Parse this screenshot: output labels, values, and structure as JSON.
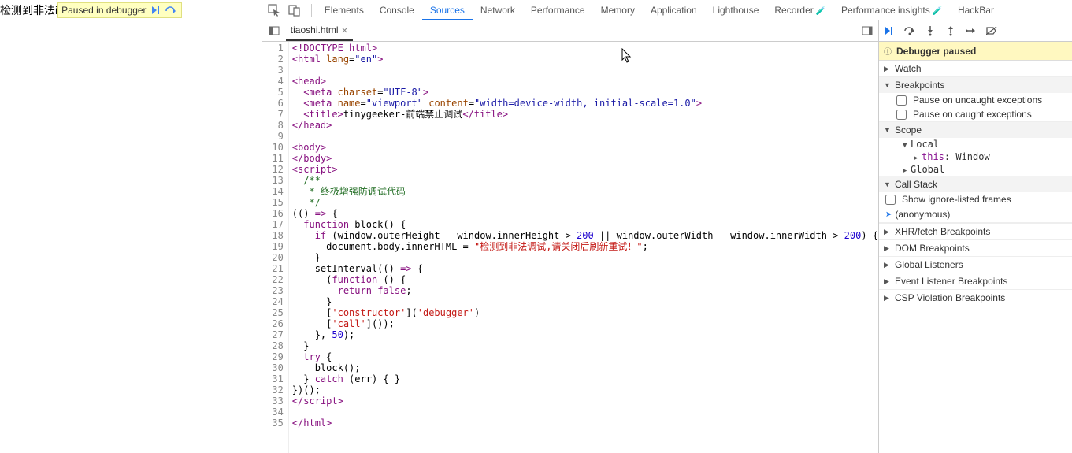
{
  "leftPane": {
    "detectedText": "检测到非法i",
    "pausedLabel": "Paused in debugger"
  },
  "tabs": [
    "Elements",
    "Console",
    "Sources",
    "Network",
    "Performance",
    "Memory",
    "Application",
    "Lighthouse",
    "Recorder",
    "Performance insights",
    "HackBar"
  ],
  "activeTab": "Sources",
  "experimentTabs": [
    "Recorder",
    "Performance insights"
  ],
  "fileTab": {
    "name": "tiaoshi.html"
  },
  "code": {
    "lines": [
      {
        "n": 1,
        "html": "<span class='tag'>&lt;!DOCTYPE html&gt;</span>"
      },
      {
        "n": 2,
        "html": "<span class='tag'>&lt;html</span> <span class='attrn'>lang</span>=<span class='attrv'>\"en\"</span><span class='tag'>&gt;</span>"
      },
      {
        "n": 3,
        "html": ""
      },
      {
        "n": 4,
        "html": "<span class='tag'>&lt;head&gt;</span>"
      },
      {
        "n": 5,
        "html": "  <span class='tag'>&lt;meta</span> <span class='attrn'>charset</span>=<span class='attrv'>\"UTF-8\"</span><span class='tag'>&gt;</span>"
      },
      {
        "n": 6,
        "html": "  <span class='tag'>&lt;meta</span> <span class='attrn'>name</span>=<span class='attrv'>\"viewport\"</span> <span class='attrn'>content</span>=<span class='attrv'>\"width=device-width, initial-scale=1.0\"</span><span class='tag'>&gt;</span>"
      },
      {
        "n": 7,
        "html": "  <span class='tag'>&lt;title&gt;</span>tinygeeker-前端禁止调试<span class='tag'>&lt;/title&gt;</span>"
      },
      {
        "n": 8,
        "html": "<span class='tag'>&lt;/head&gt;</span>"
      },
      {
        "n": 9,
        "html": ""
      },
      {
        "n": 10,
        "html": "<span class='tag'>&lt;body&gt;</span>"
      },
      {
        "n": 11,
        "html": "<span class='tag'>&lt;/body&gt;</span>"
      },
      {
        "n": 12,
        "html": "<span class='tag'>&lt;script&gt;</span>"
      },
      {
        "n": 13,
        "html": "  <span class='cmt'>/**</span>"
      },
      {
        "n": 14,
        "html": "  <span class='cmt'> * 终极增强防调试代码</span>"
      },
      {
        "n": 15,
        "html": "  <span class='cmt'> */</span>"
      },
      {
        "n": 16,
        "html": "(() <span class='kw'>=&gt;</span> {"
      },
      {
        "n": 17,
        "html": "  <span class='kw'>function</span> block() {"
      },
      {
        "n": 18,
        "html": "    <span class='kw'>if</span> (window.outerHeight - window.innerHeight &gt; <span class='num'>200</span> || window.outerWidth - window.innerWidth &gt; <span class='num'>200</span>) {"
      },
      {
        "n": 19,
        "html": "      document.body.innerHTML = <span class='str'>\"检测到非法调试,请关闭后刷新重试！\"</span>;"
      },
      {
        "n": 20,
        "html": "    }"
      },
      {
        "n": 21,
        "html": "    setInterval(() <span class='kw'>=&gt;</span> {"
      },
      {
        "n": 22,
        "html": "      (<span class='kw'>function</span> () {"
      },
      {
        "n": 23,
        "html": "        <span class='kw'>return</span> <span class='kw'>false</span>;"
      },
      {
        "n": 24,
        "html": "      }"
      },
      {
        "n": 25,
        "html": "      [<span class='str'>'constructor'</span>](<span class='str'>'debugger'</span>)"
      },
      {
        "n": 26,
        "html": "      [<span class='str'>'call'</span>]());"
      },
      {
        "n": 27,
        "html": "    }, <span class='num'>50</span>);"
      },
      {
        "n": 28,
        "html": "  }"
      },
      {
        "n": 29,
        "html": "  <span class='kw'>try</span> {"
      },
      {
        "n": 30,
        "html": "    block();"
      },
      {
        "n": 31,
        "html": "  } <span class='kw'>catch</span> (err) { }"
      },
      {
        "n": 32,
        "html": "})();"
      },
      {
        "n": 33,
        "html": "<span class='tag'>&lt;/script&gt;</span>"
      },
      {
        "n": 34,
        "html": ""
      },
      {
        "n": 35,
        "html": "<span class='tag'>&lt;/html&gt;</span>"
      }
    ]
  },
  "rightPanel": {
    "banner": "Debugger paused",
    "watch": "Watch",
    "breakpoints": "Breakpoints",
    "pauseUncaught": "Pause on uncaught exceptions",
    "pauseCaught": "Pause on caught exceptions",
    "scope": "Scope",
    "local": "Local",
    "thisLabel": "this",
    "thisValue": "Window",
    "global": "Global",
    "callStack": "Call Stack",
    "showIgnore": "Show ignore-listed frames",
    "anonymous": "(anonymous)",
    "xhr": "XHR/fetch Breakpoints",
    "dom": "DOM Breakpoints",
    "globalListeners": "Global Listeners",
    "eventListener": "Event Listener Breakpoints",
    "csp": "CSP Violation Breakpoints"
  }
}
